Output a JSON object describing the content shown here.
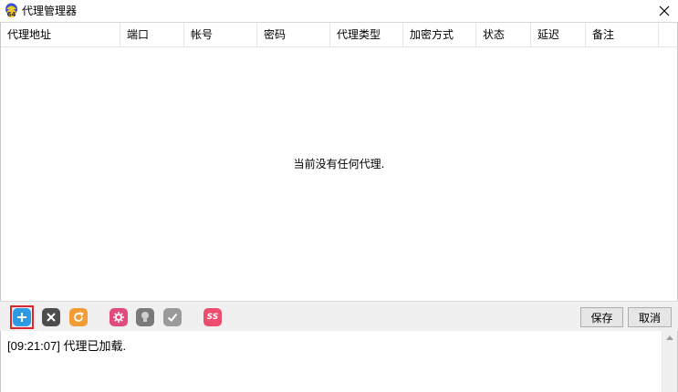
{
  "window": {
    "title": "代理管理器"
  },
  "table": {
    "columns": [
      "代理地址",
      "端口",
      "帐号",
      "密码",
      "代理类型",
      "加密方式",
      "状态",
      "延迟",
      "备注"
    ],
    "empty_message": "当前没有任何代理."
  },
  "toolbar": {
    "icons": [
      {
        "name": "add-icon",
        "color": "#2d9be3"
      },
      {
        "name": "delete-icon",
        "color": "#4d4d4d"
      },
      {
        "name": "refresh-icon",
        "color": "#f39c36"
      },
      {
        "name": "settings-icon",
        "color": "#e24a7c"
      },
      {
        "name": "bulb-icon",
        "color": "#7a7a7a"
      },
      {
        "name": "check-icon",
        "color": "#9a9a9a"
      },
      {
        "name": "ss-icon",
        "color": "#ef4d6f"
      }
    ],
    "ss_label": "SS",
    "save_label": "保存",
    "cancel_label": "取消"
  },
  "log": {
    "lines": [
      "[09:21:07] 代理已加载."
    ]
  }
}
